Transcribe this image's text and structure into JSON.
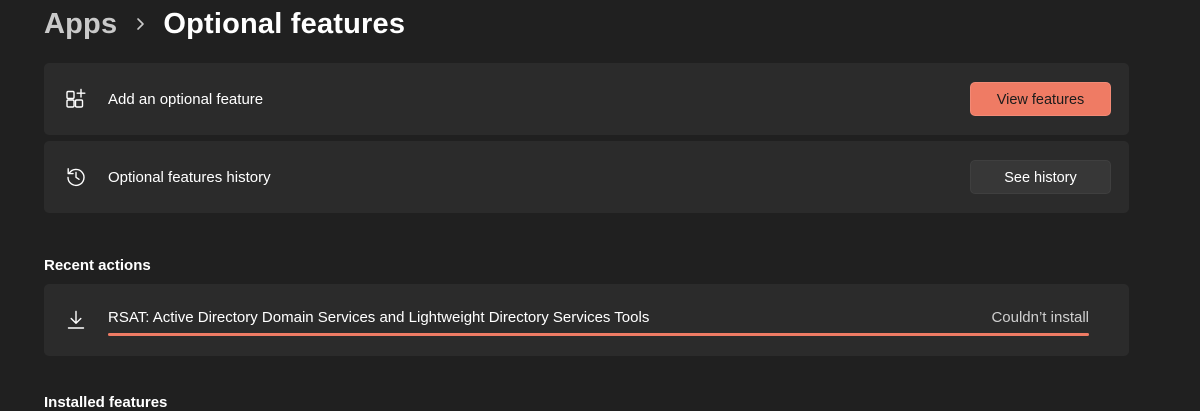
{
  "breadcrumb": {
    "parent": "Apps",
    "current": "Optional features"
  },
  "add_feature": {
    "label": "Add an optional feature",
    "button_label": "View features",
    "icon": "add-apps-icon"
  },
  "history": {
    "label": "Optional features history",
    "button_label": "See history",
    "icon": "history-icon"
  },
  "recent_actions": {
    "title": "Recent actions",
    "items": [
      {
        "name": "RSAT: Active Directory Domain Services and Lightweight Directory Services Tools",
        "status": "Couldn’t install",
        "progress": 1.0,
        "icon": "download-icon"
      }
    ]
  },
  "installed_features": {
    "title": "Installed features"
  },
  "colors": {
    "accent": "#ef7b64",
    "background": "#202020",
    "card": "#2b2b2b"
  }
}
